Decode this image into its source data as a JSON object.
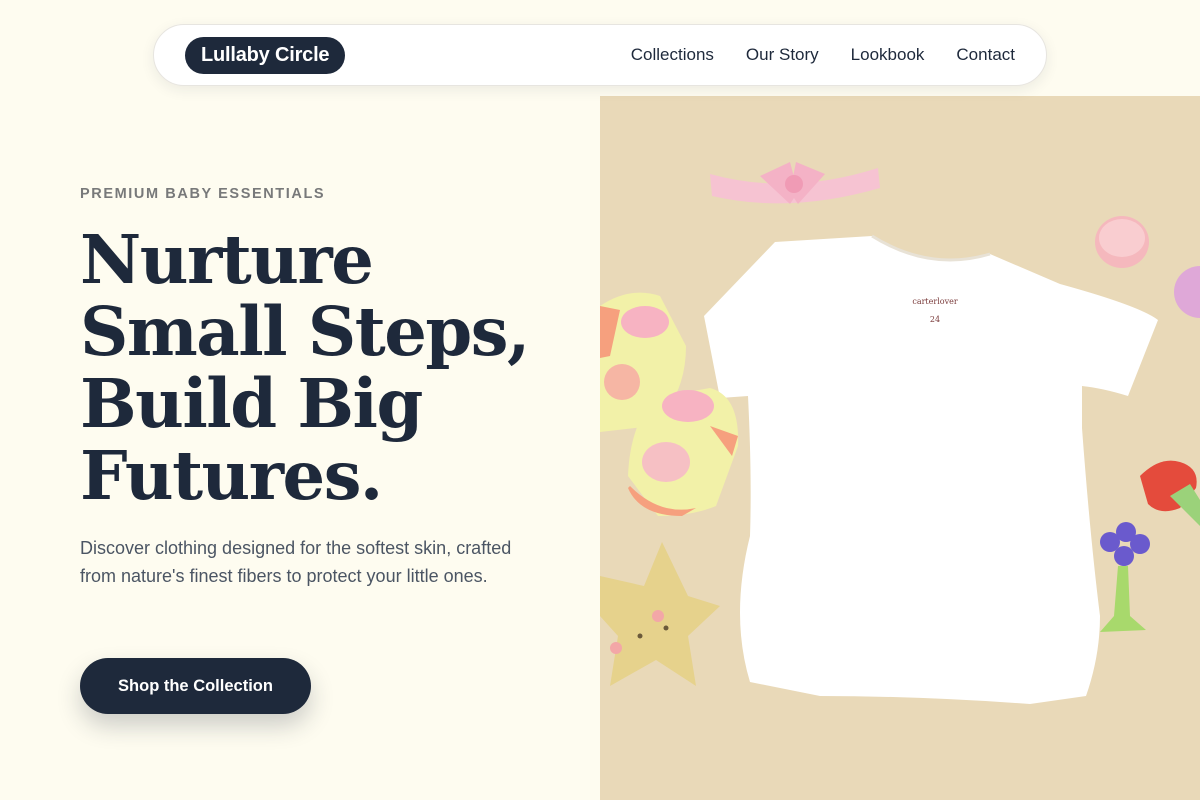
{
  "nav": {
    "brand": "Lullaby Circle",
    "links": [
      "Collections",
      "Our Story",
      "Lookbook",
      "Contact"
    ]
  },
  "hero": {
    "eyebrow": "PREMIUM BABY ESSENTIALS",
    "headline_lines": [
      "Nurture",
      "Small Steps,",
      "Build Big",
      "Futures."
    ],
    "subtext": "Discover clothing designed for the softest skin, crafted from nature's finest fibers to protect your little ones.",
    "cta_label": "Shop the Collection"
  },
  "image": {
    "shirt_tag_brand": "carterlover",
    "shirt_tag_size": "24"
  },
  "colors": {
    "background": "#fefcf0",
    "navy": "#1e293b",
    "image_background": "#e9d9b8"
  }
}
